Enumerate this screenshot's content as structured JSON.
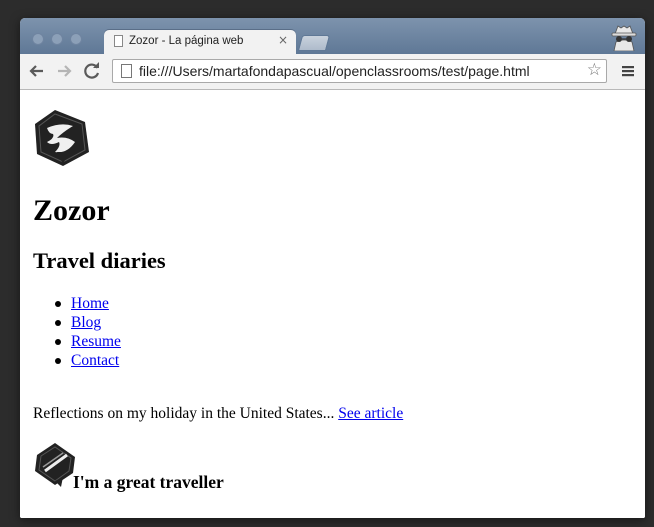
{
  "browser": {
    "tab_title": "Zozor - La página web",
    "tab_close": "×",
    "url": "file:///Users/martafondapascual/openclassrooms/test/page.html",
    "back_icon": "arrow-left-icon",
    "forward_icon": "arrow-right-icon",
    "reload_icon": "reload-icon",
    "bookmark_icon": "star-icon",
    "menu_icon": "hamburger-menu-icon",
    "titlebar_color": "#6a83a1"
  },
  "page": {
    "title": "Zozor",
    "subtitle": "Travel diaries",
    "nav": [
      "Home",
      "Blog",
      "Resume",
      "Contact"
    ],
    "paragraph_text": "Reflections on my holiday in the United States... ",
    "article_link": "See article ",
    "section_heading": "I'm a great traveller",
    "link_color": "#0000ee"
  }
}
